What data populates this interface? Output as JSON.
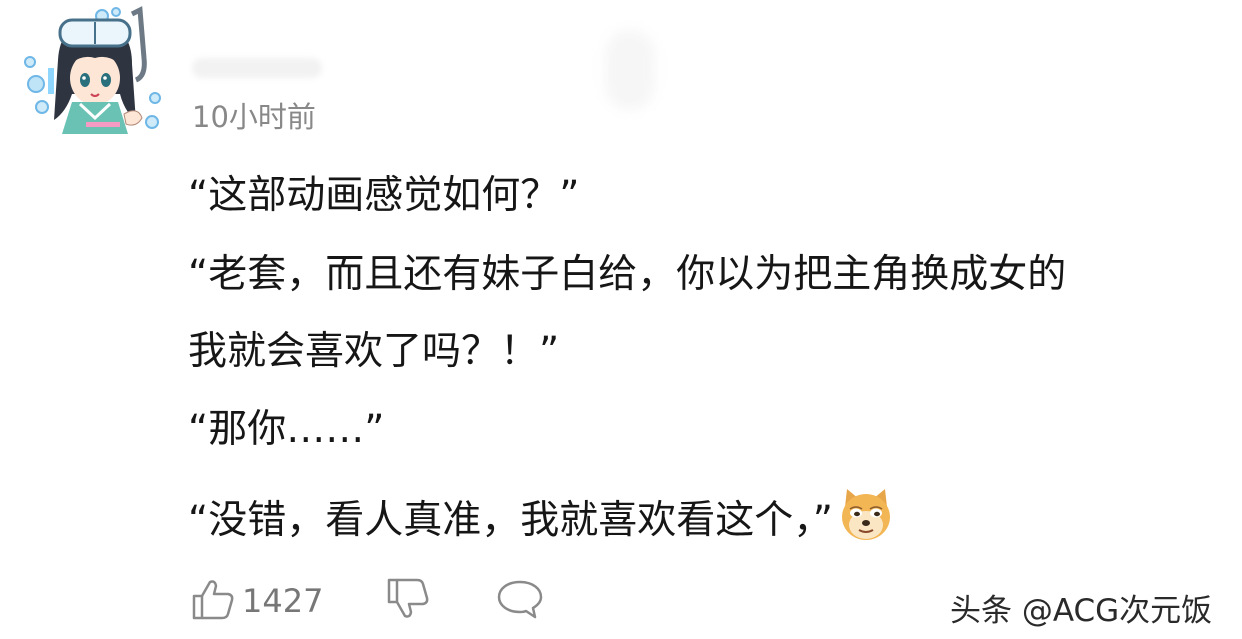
{
  "comment": {
    "timestamp": "10小时前",
    "lines": [
      "“这部动画感觉如何？”",
      "“老套，而且还有妹子白给，你以为把主角换成女的",
      "我就会喜欢了吗？！”",
      "“那你……”",
      "“没错，看人真准，我就喜欢看这个，”"
    ],
    "emoji": "doge-emoji"
  },
  "actions": {
    "like_count": "1427",
    "icons": [
      "thumbs-up-icon",
      "thumbs-down-icon",
      "reply-bubble-icon"
    ]
  },
  "watermark": "头条 @ACG次元饭",
  "colors": {
    "text": "#161616",
    "muted": "#888888",
    "icon": "#8a8a8a"
  }
}
